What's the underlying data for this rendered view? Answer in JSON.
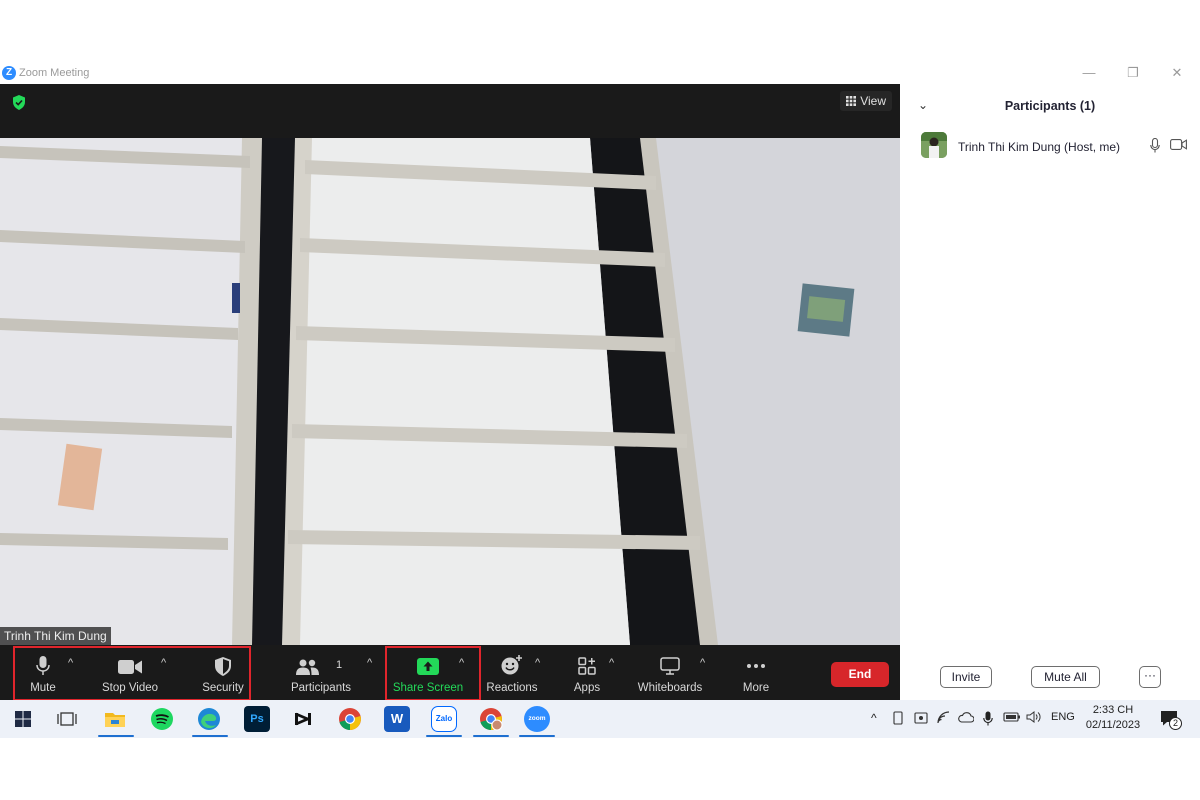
{
  "window": {
    "logo_letter": "Z",
    "title": "Zoom Meeting",
    "minimize": "—",
    "restore": "❐",
    "close": "✕"
  },
  "meeting": {
    "view_label": "View",
    "participant_name": "Trinh Thi Kim Dung"
  },
  "toolbar": {
    "mute": "Mute",
    "stop_video": "Stop Video",
    "security": "Security",
    "participants": "Participants",
    "participants_count": "1",
    "share_screen": "Share Screen",
    "reactions": "Reactions",
    "apps": "Apps",
    "whiteboards": "Whiteboards",
    "more": "More",
    "end": "End",
    "caret": "^",
    "colors": {
      "highlight": "#e0252c",
      "share_green": "#23d959",
      "end_red": "#d7262a"
    }
  },
  "participants_panel": {
    "collapse_icon": "⌄",
    "title": "Participants (1)",
    "rows": [
      {
        "name": "Trinh Thi Kim Dung (Host, me)"
      }
    ],
    "invite": "Invite",
    "mute_all": "Mute All",
    "more": "···"
  },
  "taskbar": {
    "icons": [
      "windows-start-icon",
      "task-view-icon",
      "file-explorer-icon",
      "spotify-icon",
      "edge-icon",
      "photoshop-icon",
      "capcut-icon",
      "chrome-icon",
      "word-icon",
      "zalo-icon",
      "chrome-profile-icon",
      "zoom-icon"
    ],
    "ps_label": "Ps",
    "word_label": "W",
    "zalo_label": "Zalo",
    "zoom_label": "zoom",
    "language": "ENG",
    "time": "2:33 CH",
    "date": "02/11/2023",
    "notification_count": "2",
    "tray_up": "^"
  }
}
